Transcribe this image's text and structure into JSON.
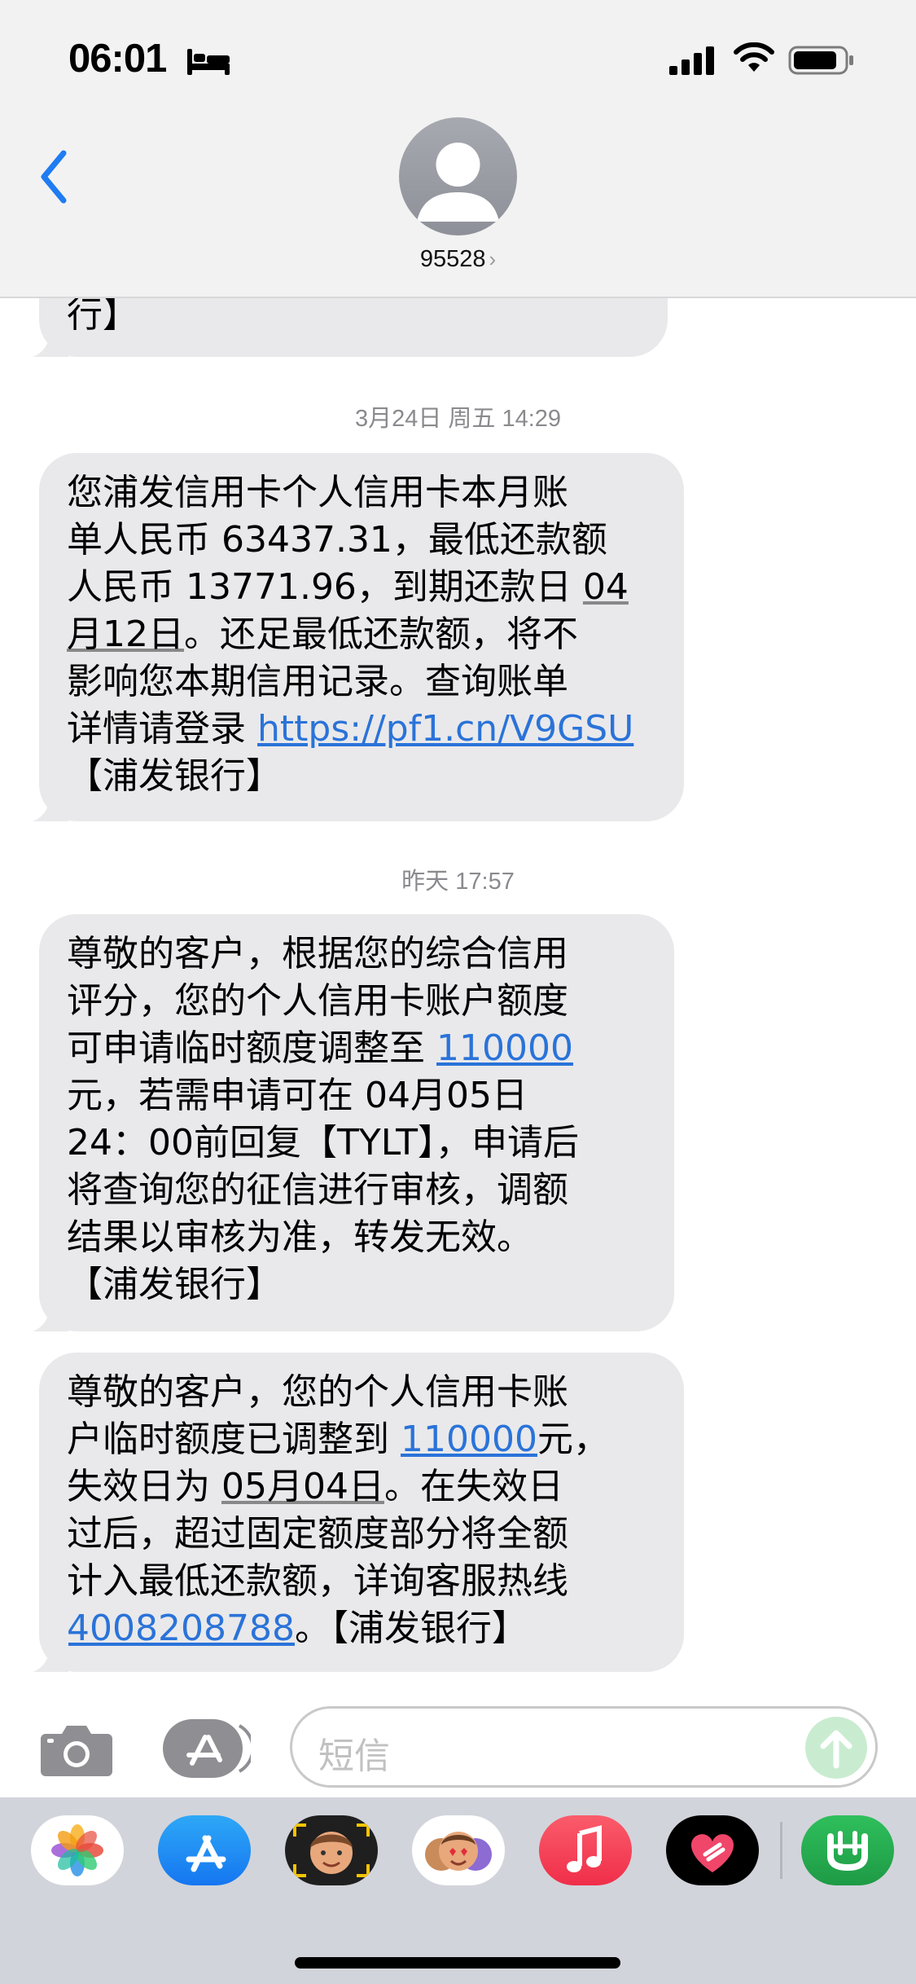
{
  "status_bar": {
    "time": "06:01"
  },
  "header": {
    "contact_name": "95528",
    "chevron": "›"
  },
  "thread": {
    "partial_message_tail": "行】",
    "timestamps": [
      {
        "date": "3月24日 周五",
        "time": "14:29"
      },
      {
        "date": "昨天",
        "time": "17:57"
      }
    ],
    "messages": [
      {
        "lines": [
          {
            "text": "您浦发信用卡个人信用卡本月账"
          },
          {
            "text": "单人民币 63437.31，最低还款额"
          },
          {
            "pre": "人民币 13771.96，到期还款日 ",
            "u": "04"
          },
          {
            "u": "月12日",
            "post": "。还足最低还款额，将不"
          },
          {
            "text": "影响您本期信用记录。查询账单"
          },
          {
            "pre": "详情请登录 ",
            "link": "https://pf1.cn/V9GSU"
          },
          {
            "text": "【浦发银行】"
          }
        ]
      },
      {
        "lines": [
          {
            "text": "尊敬的客户，根据您的综合信用"
          },
          {
            "text": "评分，您的个人信用卡账户额度"
          },
          {
            "pre": "可申请临时额度调整至 ",
            "link": "110000"
          },
          {
            "text": "元，若需申请可在 04月05日"
          },
          {
            "text": "24：00前回复【TYLT】，申请后"
          },
          {
            "text": "将查询您的征信进行审核，调额"
          },
          {
            "text": "结果以审核为准，转发无效。"
          },
          {
            "text": "【浦发银行】"
          }
        ]
      },
      {
        "lines": [
          {
            "text": "尊敬的客户，您的个人信用卡账"
          },
          {
            "pre": "户临时额度已调整到 ",
            "link": "110000",
            "post": "元，"
          },
          {
            "pre": "失效日为 ",
            "u": "05月04日",
            "post": "。在失效日"
          },
          {
            "text": "过后，超过固定额度部分将全额"
          },
          {
            "text": "计入最低还款额，详询客服热线"
          },
          {
            "link": "4008208788",
            "post": "。【浦发银行】"
          }
        ]
      }
    ]
  },
  "composer": {
    "placeholder": "短信"
  },
  "app_tray": {
    "apps": [
      {
        "name": "photos"
      },
      {
        "name": "app-store"
      },
      {
        "name": "memoji"
      },
      {
        "name": "memoji-stickers"
      },
      {
        "name": "music"
      },
      {
        "name": "digital-touch"
      },
      {
        "name": "green-app"
      }
    ]
  },
  "colors": {
    "bubble": "#e9e9eb",
    "link": "#2a73d9",
    "header_bg": "#f2f2f2",
    "tray_bg": "#d2d4db",
    "accent_blue": "#1f7cf2",
    "send_green": "#c9ecd0"
  }
}
